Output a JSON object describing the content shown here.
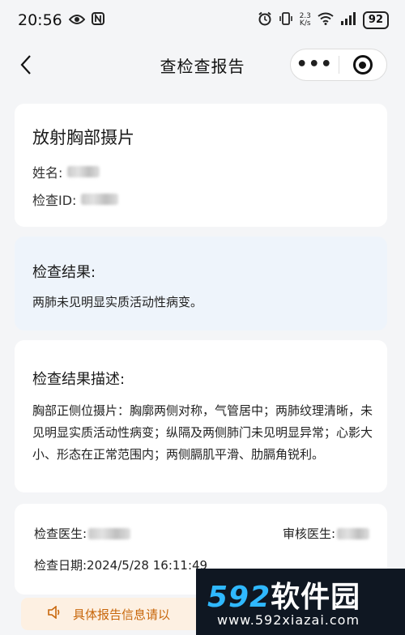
{
  "status_bar": {
    "time": "20:56",
    "net_speed_value": "2.3",
    "net_speed_unit": "K/s",
    "battery": "92"
  },
  "nav": {
    "title": "查检查报告"
  },
  "patient_card": {
    "title": "放射胸部摄片",
    "name_label": "姓名:",
    "exam_id_label": "检查ID:"
  },
  "result": {
    "title": "检查结果:",
    "text": "两肺未见明显实质活动性病变。"
  },
  "description": {
    "title": "检查结果描述:",
    "text": "胸部正侧位摄片：胸廓两侧对称，气管居中；两肺纹理清晰，未见明显实质活动性病变；纵隔及两侧肺门未见明显异常；心影大小、形态在正常范围内；两侧膈肌平滑、肋膈角锐利。"
  },
  "doctor": {
    "exam_doctor_label": "检查医生:",
    "review_doctor_label": "审核医生:",
    "exam_date": "检查日期:2024/5/28 16:11:49"
  },
  "notice": {
    "text": "具体报告信息请以"
  },
  "watermark": {
    "number": "592",
    "text": "软件园",
    "url": "www.592xiazai.com"
  },
  "colors": {
    "accent_orange": "#c8660a",
    "result_bg": "#eef4fb",
    "page_bg": "#f4f5f7"
  }
}
